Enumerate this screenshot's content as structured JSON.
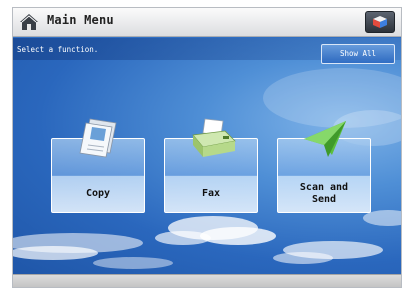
{
  "header": {
    "title": "Main Menu",
    "home_icon": "home-icon",
    "settings_icon": "cube-icon"
  },
  "info": {
    "instruction": "Select a function.",
    "show_all_label": "Show All"
  },
  "functions": [
    {
      "label": "Copy",
      "icon": "copy-documents-icon"
    },
    {
      "label": "Fax",
      "icon": "fax-machine-icon"
    },
    {
      "label": "Scan and Send",
      "icon": "paper-plane-icon"
    }
  ],
  "colors": {
    "sky_top": "#2a67bd",
    "sky_light": "#7fb3e8",
    "titlebar": "#dcdde0",
    "plane_green": "#4caf3a"
  }
}
